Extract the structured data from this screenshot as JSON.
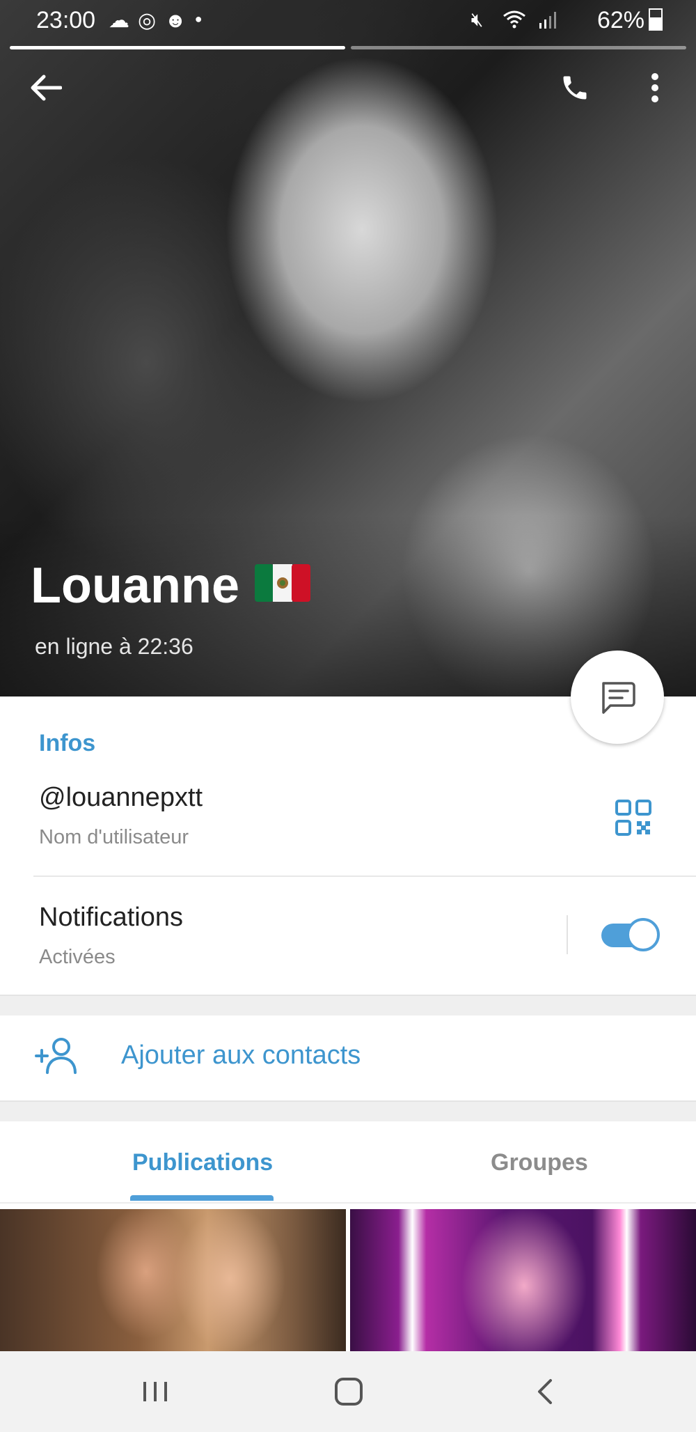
{
  "status_bar": {
    "time": "23:00",
    "left_icons": [
      "cloud-icon",
      "instagram-icon",
      "smiley-icon",
      "dot-icon"
    ],
    "right_icons": [
      "mute-icon",
      "wifi-icon",
      "signal-icon"
    ],
    "battery": "62%"
  },
  "toolbar": {
    "back_icon": "back-arrow-icon",
    "call_icon": "phone-icon",
    "menu_icon": "more-vertical-icon"
  },
  "profile": {
    "name": "Louanne",
    "flag": "mexico-flag",
    "status": "en ligne à 22:36"
  },
  "fab": {
    "icon": "message-icon"
  },
  "info": {
    "section_title": "Infos",
    "username": "@louannepxtt",
    "username_label": "Nom d'utilisateur",
    "notifications_title": "Notifications",
    "notifications_status": "Activées",
    "notifications_on": true
  },
  "actions": {
    "add_contact": "Ajouter aux contacts"
  },
  "tabs": [
    {
      "label": "Publications",
      "active": true
    },
    {
      "label": "Groupes",
      "active": false
    }
  ],
  "colors": {
    "accent": "#3d95ce",
    "toggle": "#4f9fd9"
  }
}
